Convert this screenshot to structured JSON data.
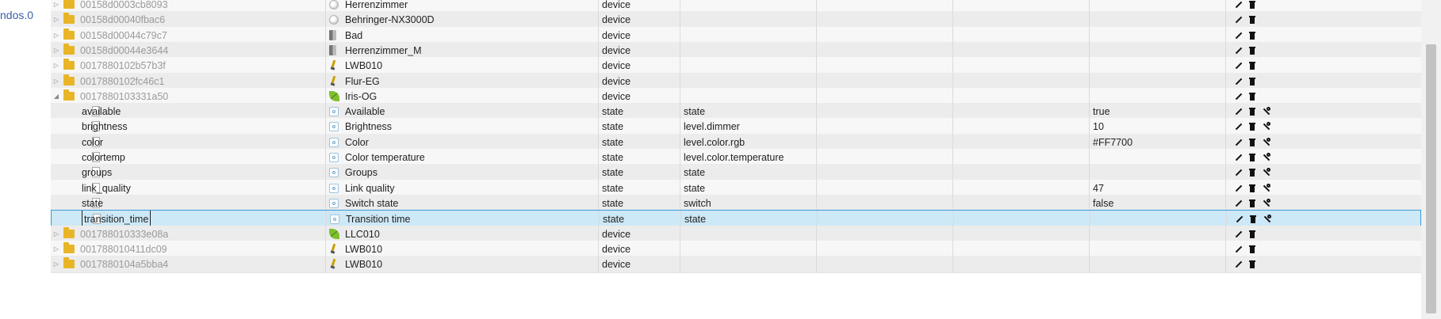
{
  "left_panel": {
    "tree_label": "ndos.0"
  },
  "rows": [
    {
      "id": "00158d0003cb8093",
      "name": "Herrenzimmer",
      "type": "device",
      "role": "",
      "value": "",
      "kind": "device",
      "expand": "collapsed",
      "icon": "bulb-circle-icon",
      "wrench": false
    },
    {
      "id": "00158d00040fbac6",
      "name": "Behringer-NX3000D",
      "type": "device",
      "role": "",
      "value": "",
      "kind": "device",
      "expand": "collapsed",
      "icon": "bulb-circle-icon",
      "wrench": false
    },
    {
      "id": "00158d00044c79c7",
      "name": "Bad",
      "type": "device",
      "role": "",
      "value": "",
      "kind": "device",
      "expand": "collapsed",
      "icon": "panel-icon",
      "wrench": false
    },
    {
      "id": "00158d00044e3644",
      "name": "Herrenzimmer_M",
      "type": "device",
      "role": "",
      "value": "",
      "kind": "device",
      "expand": "collapsed",
      "icon": "panel-icon",
      "wrench": false
    },
    {
      "id": "0017880102b57b3f",
      "name": "LWB010",
      "type": "device",
      "role": "",
      "value": "",
      "kind": "device",
      "expand": "collapsed",
      "icon": "bulb-icon",
      "wrench": false
    },
    {
      "id": "0017880102fc46c1",
      "name": "Flur-EG",
      "type": "device",
      "role": "",
      "value": "",
      "kind": "device",
      "expand": "collapsed",
      "icon": "bulb-icon",
      "wrench": false
    },
    {
      "id": "0017880103331a50",
      "name": "Iris-OG",
      "type": "device",
      "role": "",
      "value": "",
      "kind": "device",
      "expand": "expanded",
      "icon": "leaf-lamp-icon",
      "wrench": false
    },
    {
      "id": "available",
      "name": "Available",
      "type": "state",
      "role": "state",
      "value": "true",
      "kind": "state",
      "expand": "none",
      "icon": "state-icon",
      "wrench": true
    },
    {
      "id": "brightness",
      "name": "Brightness",
      "type": "state",
      "role": "level.dimmer",
      "value": "10",
      "kind": "state",
      "expand": "none",
      "icon": "state-icon",
      "wrench": true
    },
    {
      "id": "color",
      "name": "Color",
      "type": "state",
      "role": "level.color.rgb",
      "value": "#FF7700",
      "kind": "state",
      "expand": "none",
      "icon": "state-icon",
      "wrench": true
    },
    {
      "id": "colortemp",
      "name": "Color temperature",
      "type": "state",
      "role": "level.color.temperature",
      "value": "",
      "kind": "state",
      "expand": "none",
      "icon": "state-icon",
      "wrench": true
    },
    {
      "id": "groups",
      "name": "Groups",
      "type": "state",
      "role": "state",
      "value": "",
      "kind": "state",
      "expand": "none",
      "icon": "state-icon",
      "wrench": true
    },
    {
      "id": "link_quality",
      "name": "Link quality",
      "type": "state",
      "role": "state",
      "value": "47",
      "kind": "state",
      "expand": "none",
      "icon": "state-icon",
      "wrench": true
    },
    {
      "id": "state",
      "name": "Switch state",
      "type": "state",
      "role": "switch",
      "value": "false",
      "kind": "state",
      "expand": "none",
      "icon": "state-icon",
      "wrench": true
    },
    {
      "id": "transition_time",
      "name": "Transition time",
      "type": "state",
      "role": "state",
      "value": "",
      "kind": "state",
      "expand": "none",
      "icon": "state-icon",
      "wrench": true,
      "selected": true
    },
    {
      "id": "001788010333e08a",
      "name": "LLC010",
      "type": "device",
      "role": "",
      "value": "",
      "kind": "device",
      "expand": "collapsed",
      "icon": "leaf-lamp-icon",
      "wrench": false
    },
    {
      "id": "001788010411dc09",
      "name": "LWB010",
      "type": "device",
      "role": "",
      "value": "",
      "kind": "device",
      "expand": "collapsed",
      "icon": "bulb-icon",
      "wrench": false
    },
    {
      "id": "0017880104a5bba4",
      "name": "LWB010",
      "type": "device",
      "role": "",
      "value": "",
      "kind": "device",
      "expand": "collapsed",
      "icon": "bulb-icon",
      "wrench": false
    }
  ]
}
